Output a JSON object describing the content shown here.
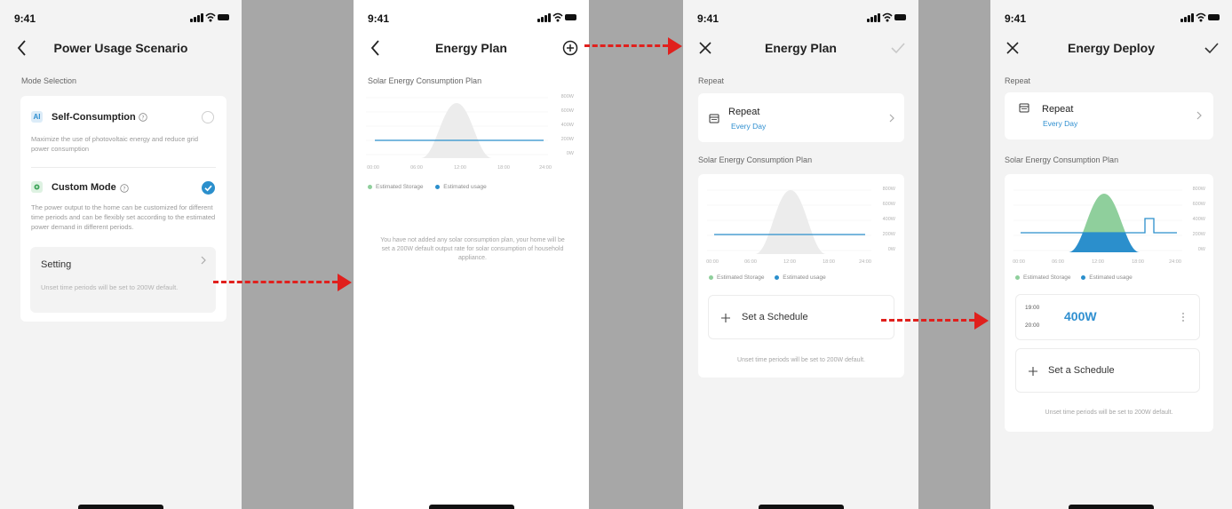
{
  "status_time": "9:41",
  "colors": {
    "accent": "#2f8fd0",
    "usage_line": "#2b8fcc",
    "storage_fill": "#8fcf9c",
    "arrow": "#e0201d",
    "background_gap": "#a7a7a7"
  },
  "screen1": {
    "title": "Power Usage Scenario",
    "nav_left_icon": "back-chevron-icon",
    "section_label": "Mode Selection",
    "self_consumption": {
      "chip": "AI",
      "title": "Self-Consumption",
      "desc": "Maximize the use of photovoltaic energy and reduce grid power consumption",
      "selected": false
    },
    "custom_mode": {
      "title": "Custom Mode",
      "desc": "The power output to the home can be customized for different time periods and can be flexibly set according to the estimated power demand in different periods.",
      "selected": true
    },
    "setting": {
      "label": "Setting",
      "note": "Unset time periods will be set to 200W default."
    }
  },
  "screen2": {
    "title": "Energy Plan",
    "nav_left_icon": "back-chevron-icon",
    "nav_right_icon": "add-circle-icon",
    "section_label": "Solar Energy Consumption Plan",
    "legend_storage": "Estimated Storage",
    "legend_usage": "Estimated usage",
    "empty_message": "You have not added any solar consumption plan, your home will be set a 200W default output rate for solar consumption of household appliance."
  },
  "screen3": {
    "title": "Energy Plan",
    "nav_left_icon": "close-icon",
    "nav_right_icon": "check-icon",
    "repeat_section": "Repeat",
    "repeat_title": "Repeat",
    "repeat_value": "Every Day",
    "plan_section": "Solar Energy Consumption Plan",
    "legend_storage": "Estimated Storage",
    "legend_usage": "Estimated usage",
    "add_schedule": "Set a Schedule",
    "footer_note": "Unset time periods will be set to 200W default."
  },
  "screen4": {
    "title": "Energy Deploy",
    "nav_left_icon": "close-icon",
    "nav_right_icon": "check-icon",
    "repeat_section": "Repeat",
    "repeat_title": "Repeat",
    "repeat_value": "Every Day",
    "plan_section": "Solar Energy Consumption Plan",
    "legend_storage": "Estimated Storage",
    "legend_usage": "Estimated usage",
    "schedule": {
      "start": "19:00",
      "end": "20:00",
      "power": "400W"
    },
    "add_schedule": "Set a Schedule",
    "footer_note": "Unset time periods will be set to 200W default."
  },
  "chart_ticks": {
    "y": [
      "800W",
      "600W",
      "400W",
      "200W",
      "0W"
    ],
    "x": [
      "00:00",
      "06:00",
      "12:00",
      "18:00",
      "24:00"
    ]
  }
}
